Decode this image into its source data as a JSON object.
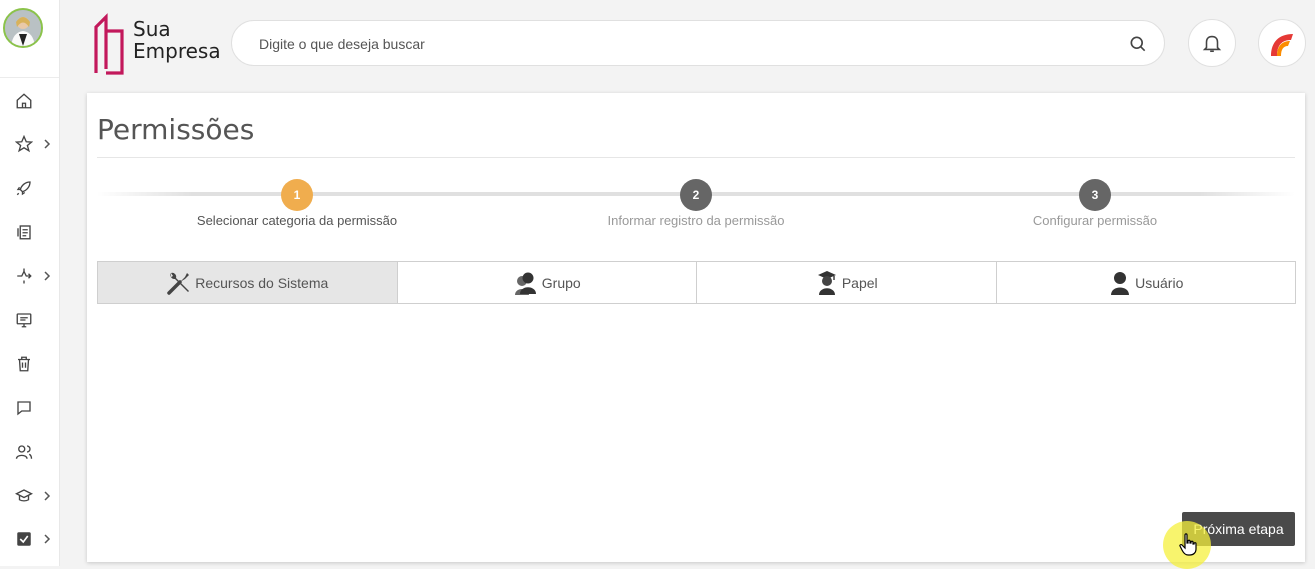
{
  "brand": {
    "line1": "Sua",
    "line2": "Empresa",
    "color": "#c2185b"
  },
  "search": {
    "placeholder": "Digite o que deseja buscar"
  },
  "sidebar": {
    "items": [
      {
        "icon": "home-icon"
      },
      {
        "icon": "star-icon",
        "expandable": true
      },
      {
        "icon": "rocket-icon"
      },
      {
        "icon": "documents-icon"
      },
      {
        "icon": "workflow-icon",
        "expandable": true
      },
      {
        "icon": "monitor-icon"
      },
      {
        "icon": "trash-icon"
      },
      {
        "icon": "chat-icon"
      },
      {
        "icon": "users-icon"
      },
      {
        "icon": "graduation-cap-icon",
        "expandable": true
      },
      {
        "icon": "task-check-icon",
        "expandable": true
      }
    ]
  },
  "page": {
    "title": "Permissões"
  },
  "stepper": {
    "steps": [
      {
        "number": "1",
        "label": "Selecionar categoria da permissão",
        "state": "active",
        "color": "#f0ad4e"
      },
      {
        "number": "2",
        "label": "Informar registro da permissão",
        "state": "pending",
        "color": "#666666"
      },
      {
        "number": "3",
        "label": "Configurar permissão",
        "state": "pending",
        "color": "#666666"
      }
    ]
  },
  "tabs": [
    {
      "label": "Recursos do Sistema",
      "icon": "tools-icon",
      "active": true
    },
    {
      "label": "Grupo",
      "icon": "group-icon",
      "active": false
    },
    {
      "label": "Papel",
      "icon": "graduate-icon",
      "active": false
    },
    {
      "label": "Usuário",
      "icon": "user-icon",
      "active": false
    }
  ],
  "actions": {
    "next_label": "Próxima etapa"
  }
}
